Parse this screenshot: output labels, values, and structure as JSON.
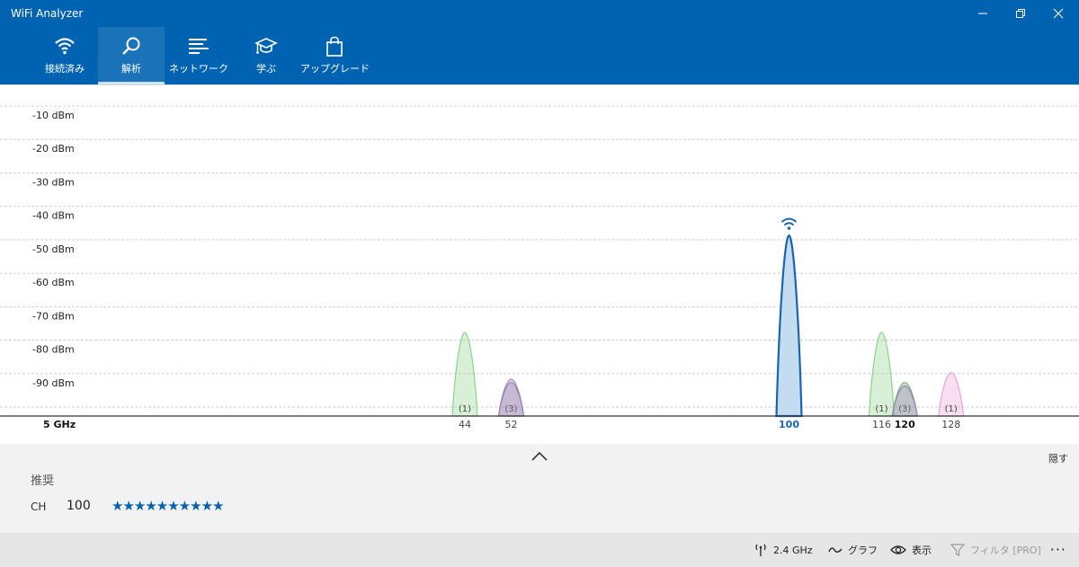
{
  "window": {
    "title": "WiFi Analyzer"
  },
  "nav": {
    "tabs": [
      {
        "label": "接続済み",
        "icon": "wifi-icon"
      },
      {
        "label": "解析",
        "icon": "magnifier-icon",
        "active": true
      },
      {
        "label": "ネットワーク",
        "icon": "list-icon"
      },
      {
        "label": "学ぶ",
        "icon": "graduation-cap-icon"
      },
      {
        "label": "アップグレード",
        "icon": "shopping-bag-icon"
      }
    ]
  },
  "chart_data": {
    "type": "area",
    "band_label": "5 GHz",
    "y_ticks": [
      "-10 dBm",
      "-20 dBm",
      "-30 dBm",
      "-40 dBm",
      "-50 dBm",
      "-60 dBm",
      "-70 dBm",
      "-80 dBm",
      "-90 dBm"
    ],
    "ylim": [
      -100,
      -5
    ],
    "grid": true,
    "x_ticks": [
      {
        "channel": 44,
        "label": "44"
      },
      {
        "channel": 52,
        "label": "52"
      },
      {
        "channel": 100,
        "label": "100",
        "highlight": true
      },
      {
        "channel": 116,
        "label": "116"
      },
      {
        "channel": 120,
        "label": "120",
        "bold": true
      },
      {
        "channel": 128,
        "label": "128"
      }
    ],
    "series": [
      {
        "channel": 44,
        "peak_dbm": -75,
        "count_label": "(1)",
        "color": "#8bd38b"
      },
      {
        "channel": 52,
        "peak_dbm": -89,
        "count_label": "(3)",
        "color": "#9a86b4"
      },
      {
        "channel": 52,
        "peak_dbm": -90,
        "count_label": "",
        "color": "#9a86b4"
      },
      {
        "channel": 100,
        "peak_dbm": -46,
        "count_label": "",
        "color": "#1a64b0",
        "connected": true
      },
      {
        "channel": 116,
        "peak_dbm": -75,
        "count_label": "(1)",
        "color": "#8bd38b"
      },
      {
        "channel": 120,
        "peak_dbm": -90,
        "count_label": "(3)",
        "color": "#7fae7f"
      },
      {
        "channel": 120,
        "peak_dbm": -91,
        "count_label": "",
        "color": "#9a86b4"
      },
      {
        "channel": 128,
        "peak_dbm": -87,
        "count_label": "(1)",
        "color": "#e7a3d8"
      }
    ]
  },
  "recommendation": {
    "title": "推奨",
    "ch_label": "CH",
    "ch_value": "100",
    "rating": 10,
    "rating_max": 10,
    "hide_label": "隠す"
  },
  "commandbar": {
    "band": "2.4 GHz",
    "graph": "グラフ",
    "display": "表示",
    "filter": "フィルタ [PRO]"
  }
}
